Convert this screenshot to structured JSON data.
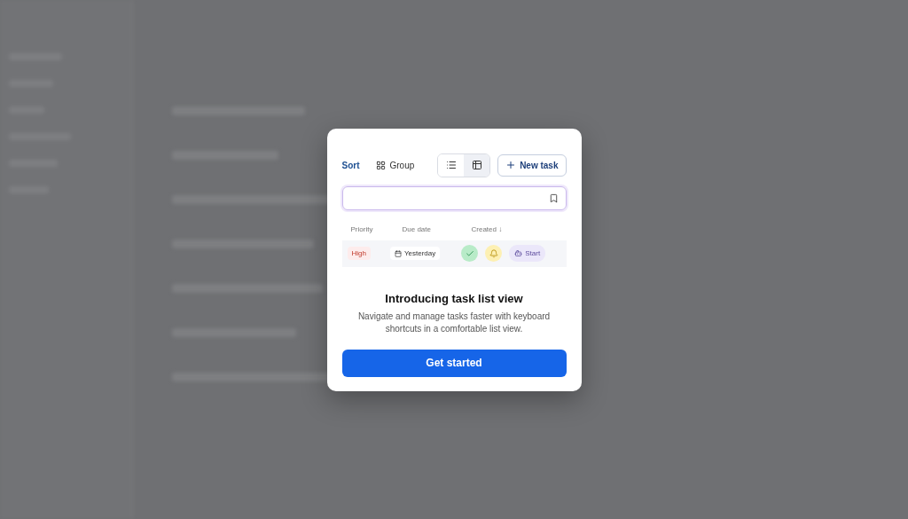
{
  "dialog": {
    "toolbar": {
      "sort": "Sort",
      "group": "Group",
      "views": [
        {
          "kind": "list",
          "selected": false
        },
        {
          "kind": "grid",
          "selected": true
        }
      ],
      "new_task": "New task"
    },
    "table": {
      "columns": [
        "Priority",
        "Due date",
        "Created ↓"
      ],
      "row": {
        "priority": "High",
        "due": "Yesterday",
        "done": true,
        "start": "Start"
      }
    },
    "title": "Introducing task list view",
    "description": "Navigate and manage tasks faster with keyboard shortcuts in a comfortable list view.",
    "button": "Get started"
  }
}
